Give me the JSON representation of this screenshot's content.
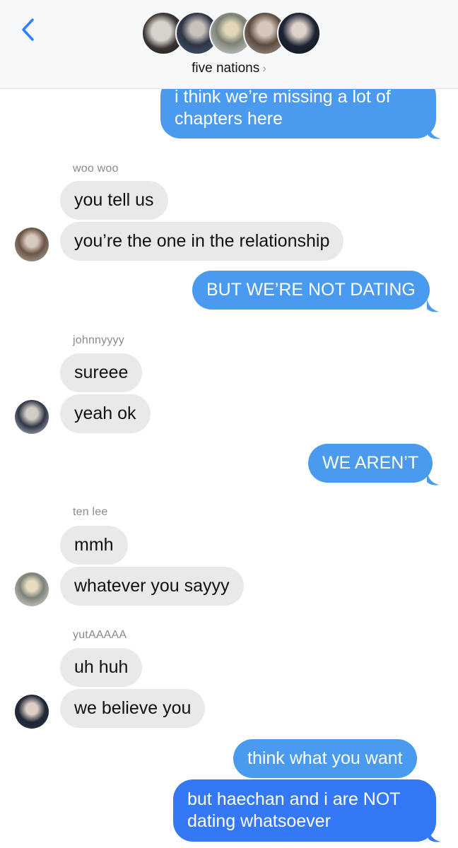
{
  "header": {
    "group_name": "five nations",
    "chevron": "›",
    "back_icon": "chevron-left-icon"
  },
  "colors": {
    "accent": "#2f80ff",
    "outgoing_bubble": "#4a9bf0",
    "outgoing_bubble_latest": "#3478f6",
    "incoming_bubble": "#e9e9eb",
    "sender_name": "#8a8a8e"
  },
  "messages": {
    "m1": "i think we’re missing a lot of chapters here",
    "sender1": "woo woo",
    "m2": "you tell us",
    "m3": "you’re the one in the relationship",
    "m4": "BUT WE’RE NOT DATING",
    "sender2": "johnnyyyy",
    "m5": "sureee",
    "m6": "yeah ok",
    "m7": "WE AREN’T",
    "sender3": "ten lee",
    "m8": "mmh",
    "m9": "whatever you sayyy",
    "sender4": "yutAAAAA",
    "m10": "uh huh",
    "m11": "we believe you",
    "m12": "think what you want",
    "m13": "but haechan and i are NOT dating whatsoever"
  }
}
